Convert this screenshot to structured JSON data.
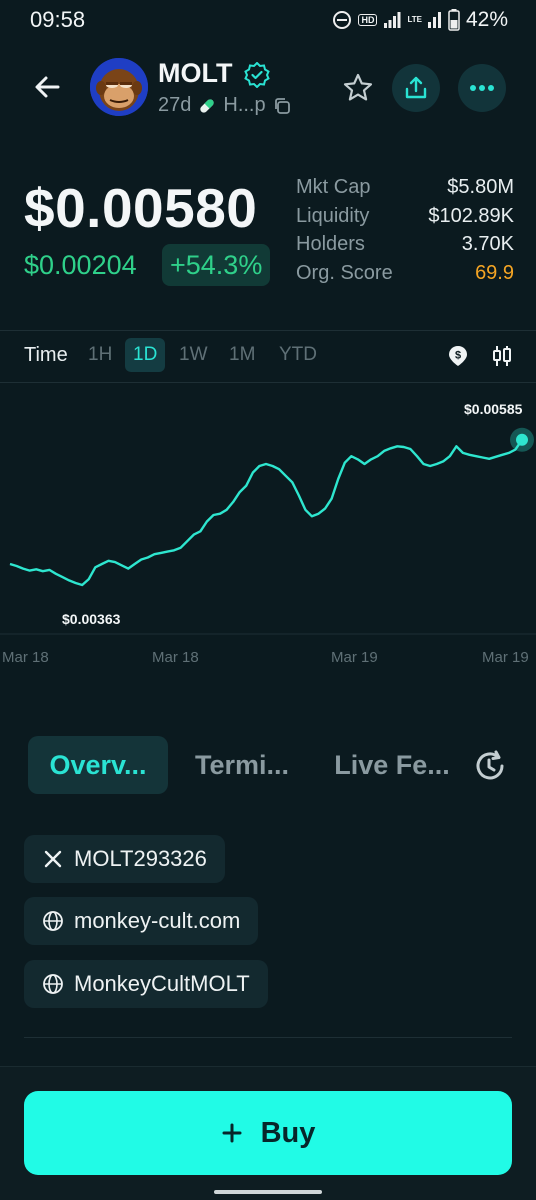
{
  "status_bar": {
    "time": "09:58",
    "battery": "42%",
    "icons": [
      "do-not-disturb-icon",
      "hd-icon",
      "signal-icon",
      "lte-icon",
      "signal-icon",
      "battery-icon"
    ],
    "hd_label": "HD",
    "lte_label": "LTE"
  },
  "header": {
    "token_name": "MOLT",
    "age": "27d",
    "source": "H...p",
    "icons": [
      "back-arrow-icon",
      "verified-icon",
      "pill-icon",
      "copy-icon",
      "star-icon",
      "share-icon",
      "more-icon"
    ]
  },
  "price": {
    "current": "$0.00580",
    "change_abs": "$0.00204",
    "change_pct": "+54.3%",
    "accent_up": "#2fd08a"
  },
  "stats": [
    {
      "label": "Mkt Cap",
      "value": "$5.80M"
    },
    {
      "label": "Liquidity",
      "value": "$102.89K"
    },
    {
      "label": "Holders",
      "value": "3.70K"
    },
    {
      "label": "Org. Score",
      "value": "69.9"
    }
  ],
  "timeframes": {
    "label": "Time",
    "options": [
      "1H",
      "1D",
      "1W",
      "1M",
      "YTD"
    ],
    "selected": "1D",
    "icons": [
      "dollar-toggle-icon",
      "candlestick-icon"
    ]
  },
  "chart_data": {
    "type": "line",
    "x_labels": [
      "Mar 18",
      "Mar 18",
      "Mar 19",
      "Mar 19"
    ],
    "high_label": "$0.00585",
    "low_label": "$0.00363",
    "line_color": "#2ee6cf",
    "values": [
      0.00395,
      0.00392,
      0.00388,
      0.00385,
      0.00387,
      0.00384,
      0.00386,
      0.0038,
      0.00375,
      0.0037,
      0.00366,
      0.00363,
      0.00372,
      0.0039,
      0.00395,
      0.004,
      0.00398,
      0.00393,
      0.00388,
      0.00395,
      0.00402,
      0.00405,
      0.0041,
      0.00412,
      0.00414,
      0.00416,
      0.0042,
      0.0043,
      0.0044,
      0.00445,
      0.0046,
      0.0047,
      0.00472,
      0.00478,
      0.0049,
      0.00505,
      0.00515,
      0.00535,
      0.00545,
      0.00548,
      0.00545,
      0.0054,
      0.0053,
      0.0052,
      0.005,
      0.00478,
      0.00468,
      0.00472,
      0.0048,
      0.00495,
      0.00525,
      0.0055,
      0.0056,
      0.00555,
      0.00548,
      0.00555,
      0.0056,
      0.00568,
      0.00572,
      0.00575,
      0.00574,
      0.00571,
      0.0056,
      0.00548,
      0.00545,
      0.00548,
      0.00552,
      0.0056,
      0.00575,
      0.00565,
      0.00562,
      0.0056,
      0.00558,
      0.00556,
      0.00559,
      0.00562,
      0.00565,
      0.0057,
      0.00585
    ],
    "ylim": [
      0.0034,
      0.006
    ]
  },
  "tabs": {
    "items": [
      "Overv...",
      "Termi...",
      "Live Fe..."
    ],
    "selected": "Overv...",
    "history_icon": "history-icon"
  },
  "links": [
    {
      "icon": "x-logo-icon",
      "text": "MOLT293326"
    },
    {
      "icon": "globe-icon",
      "text": "monkey-cult.com"
    },
    {
      "icon": "globe-icon",
      "text": "MonkeyCultMOLT"
    }
  ],
  "buy": {
    "label": "Buy",
    "icon": "plus-icon",
    "color": "#21fbe6"
  }
}
